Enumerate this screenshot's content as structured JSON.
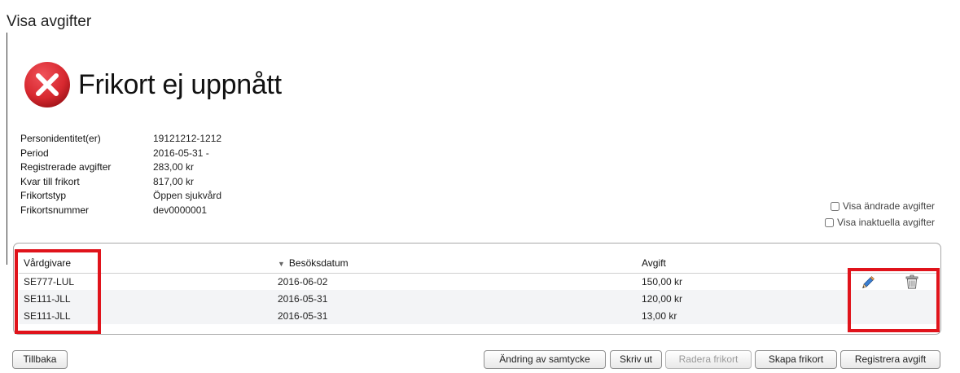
{
  "page": {
    "title": "Visa avgifter"
  },
  "status": {
    "text": "Frikort ej uppnått",
    "icon": "error-x-icon",
    "color": "#d7282f"
  },
  "info": [
    {
      "label": "Personidentitet(er)",
      "value": "19121212-1212"
    },
    {
      "label": "Period",
      "value": "2016-05-31 -"
    },
    {
      "label": "Registrerade avgifter",
      "value": "283,00 kr"
    },
    {
      "label": "Kvar till frikort",
      "value": "817,00 kr"
    },
    {
      "label": "Frikortstyp",
      "value": "Öppen sjukvård"
    },
    {
      "label": "Frikortsnummer",
      "value": "dev0000001"
    }
  ],
  "filters": {
    "show_changed": {
      "label": "Visa ändrade avgifter",
      "checked": false
    },
    "show_inactive": {
      "label": "Visa inaktuella avgifter",
      "checked": false
    }
  },
  "table": {
    "columns": [
      "Vårdgivare",
      "Besöksdatum",
      "Avgift"
    ],
    "sort_indicator": "▼",
    "rows": [
      {
        "provider": "SE777-LUL",
        "date": "2016-06-02",
        "fee": "150,00 kr",
        "edit_icon": "pencil-icon",
        "delete_icon": "trash-icon"
      },
      {
        "provider": "SE111-JLL",
        "date": "2016-05-31",
        "fee": "120,00 kr"
      },
      {
        "provider": "SE111-JLL",
        "date": "2016-05-31",
        "fee": "13,00 kr"
      }
    ]
  },
  "highlight_color": "#e0131b",
  "buttons": {
    "back": "Tillbaka",
    "consent": "Ändring av samtycke",
    "print": "Skriv ut",
    "delete_card": "Radera frikort",
    "create_card": "Skapa frikort",
    "register_fee": "Registrera avgift"
  }
}
